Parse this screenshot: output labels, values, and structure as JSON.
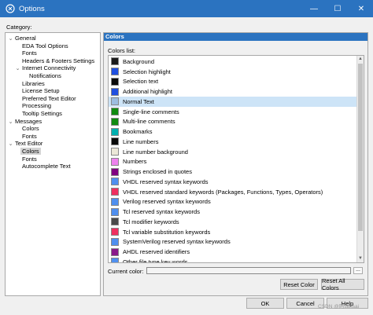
{
  "window": {
    "title": "Options",
    "controls": {
      "minimize": "—",
      "maximize": "☐",
      "close": "✕"
    }
  },
  "category": {
    "label": "Category:",
    "tree": [
      {
        "label": "General",
        "level": 0,
        "expanded": true
      },
      {
        "label": "EDA Tool Options",
        "level": 1
      },
      {
        "label": "Fonts",
        "level": 1
      },
      {
        "label": "Headers & Footers Settings",
        "level": 1
      },
      {
        "label": "Internet Connectivity",
        "level": 1,
        "expanded": true
      },
      {
        "label": "Notifications",
        "level": 2
      },
      {
        "label": "Libraries",
        "level": 1
      },
      {
        "label": "License Setup",
        "level": 1
      },
      {
        "label": "Preferred Text Editor",
        "level": 1
      },
      {
        "label": "Processing",
        "level": 1
      },
      {
        "label": "Tooltip Settings",
        "level": 1
      },
      {
        "label": "Messages",
        "level": 0,
        "expanded": true
      },
      {
        "label": "Colors",
        "level": 1
      },
      {
        "label": "Fonts",
        "level": 1
      },
      {
        "label": "Text Editor",
        "level": 0,
        "expanded": true
      },
      {
        "label": "Colors",
        "level": 1,
        "selected": true
      },
      {
        "label": "Fonts",
        "level": 1
      },
      {
        "label": "Autocomplete Text",
        "level": 1
      }
    ]
  },
  "panel": {
    "header": "Colors",
    "colors_list_label": "Colors list:",
    "colors": [
      {
        "name": "Background",
        "color": "#1a1a1a"
      },
      {
        "name": "Selection highlight",
        "color": "#1f4fe0"
      },
      {
        "name": "Selection text",
        "color": "#0a0a0a"
      },
      {
        "name": "Additional highlight",
        "color": "#1f4fe0"
      },
      {
        "name": "Normal Text",
        "color": "#9cbde0",
        "selected": true
      },
      {
        "name": "Single-line comments",
        "color": "#108a10"
      },
      {
        "name": "Multi-line comments",
        "color": "#108a10"
      },
      {
        "name": "Bookmarks",
        "color": "#00b0b0"
      },
      {
        "name": "Line numbers",
        "color": "#0a0a0a"
      },
      {
        "name": "Line number background",
        "color": "#ece8d8"
      },
      {
        "name": "Numbers",
        "color": "#ee82ee"
      },
      {
        "name": "Strings enclosed in quotes",
        "color": "#800080"
      },
      {
        "name": "VHDL reserved syntax keywords",
        "color": "#4f8fef"
      },
      {
        "name": "VHDL reserved standard keywords (Packages, Functions, Types, Operators)",
        "color": "#ef2f5f"
      },
      {
        "name": "Verilog reserved syntax keywords",
        "color": "#4f8fef"
      },
      {
        "name": "Tcl reserved syntax keywords",
        "color": "#4f8fef"
      },
      {
        "name": "Tcl modifier keywords",
        "color": "#4a4a4a"
      },
      {
        "name": "Tcl variable substitution keywords",
        "color": "#ef2f5f"
      },
      {
        "name": "SystemVerilog reserved syntax keywords",
        "color": "#4f8fef"
      },
      {
        "name": "AHDL reserved identifiers",
        "color": "#8a1a8a"
      },
      {
        "name": "Other file type key words",
        "color": "#4f8fef"
      }
    ],
    "current_color_label": "Current color:",
    "browse_label": "...",
    "reset_color": "Reset Color",
    "reset_all_colors": "Reset All Colors"
  },
  "buttons": {
    "ok": "OK",
    "cancel": "Cancel",
    "help": "Help"
  },
  "watermark": "CSDN @阿sensai"
}
